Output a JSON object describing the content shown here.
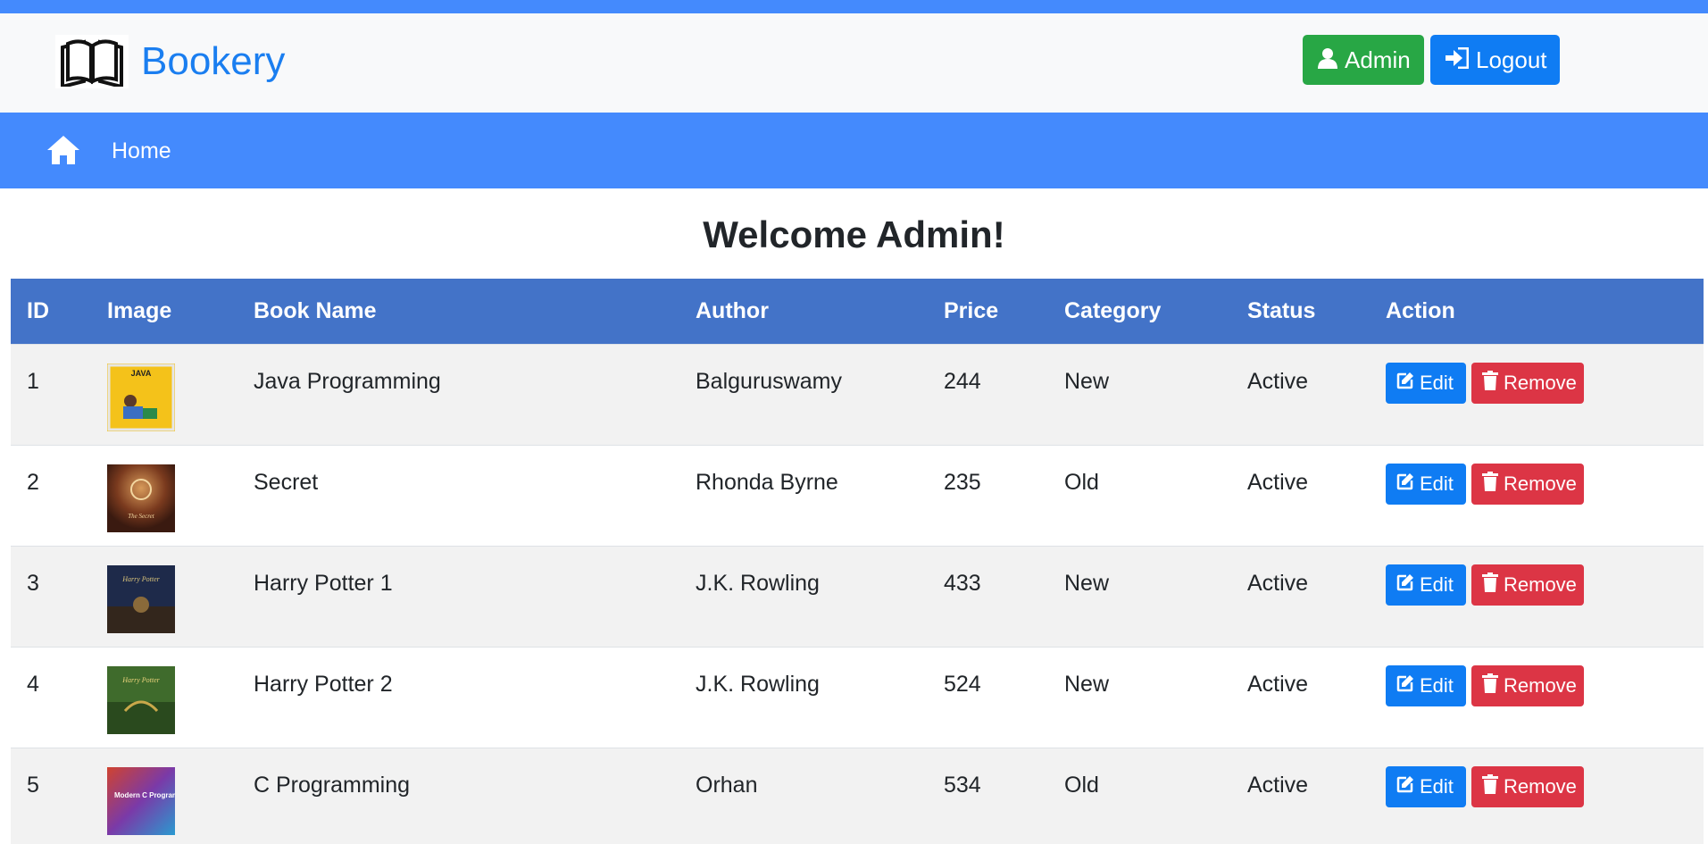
{
  "colors": {
    "primary_blue": "#448afd",
    "brand_text": "#1a7ef0",
    "table_header": "#4373c8",
    "admin_green": "#28a745",
    "button_blue": "#0f7cf3",
    "remove_red": "#dc3545"
  },
  "header": {
    "brand": "Bookery",
    "logo_icon": "open-book-icon",
    "admin_label": "Admin",
    "logout_label": "Logout"
  },
  "nav": {
    "home_icon": "home-icon",
    "home_label": "Home"
  },
  "main": {
    "welcome": "Welcome Admin!"
  },
  "table": {
    "columns": [
      "ID",
      "Image",
      "Book Name",
      "Author",
      "Price",
      "Category",
      "Status",
      "Action"
    ],
    "edit_label": "Edit",
    "remove_label": "Remove",
    "rows": [
      {
        "id": "1",
        "name": "Java Programming",
        "author": "Balguruswamy",
        "price": "244",
        "category": "New",
        "status": "Active",
        "cover_text": "JAVA"
      },
      {
        "id": "2",
        "name": "Secret",
        "author": "Rhonda Byrne",
        "price": "235",
        "category": "Old",
        "status": "Active",
        "cover_text": "The Secret"
      },
      {
        "id": "3",
        "name": "Harry Potter 1",
        "author": "J.K. Rowling",
        "price": "433",
        "category": "New",
        "status": "Active",
        "cover_text": "Harry Potter"
      },
      {
        "id": "4",
        "name": "Harry Potter 2",
        "author": "J.K. Rowling",
        "price": "524",
        "category": "New",
        "status": "Active",
        "cover_text": "Harry Potter"
      },
      {
        "id": "5",
        "name": "C Programming",
        "author": "Orhan",
        "price": "534",
        "category": "Old",
        "status": "Active",
        "cover_text": "Modern C Programming"
      }
    ]
  }
}
